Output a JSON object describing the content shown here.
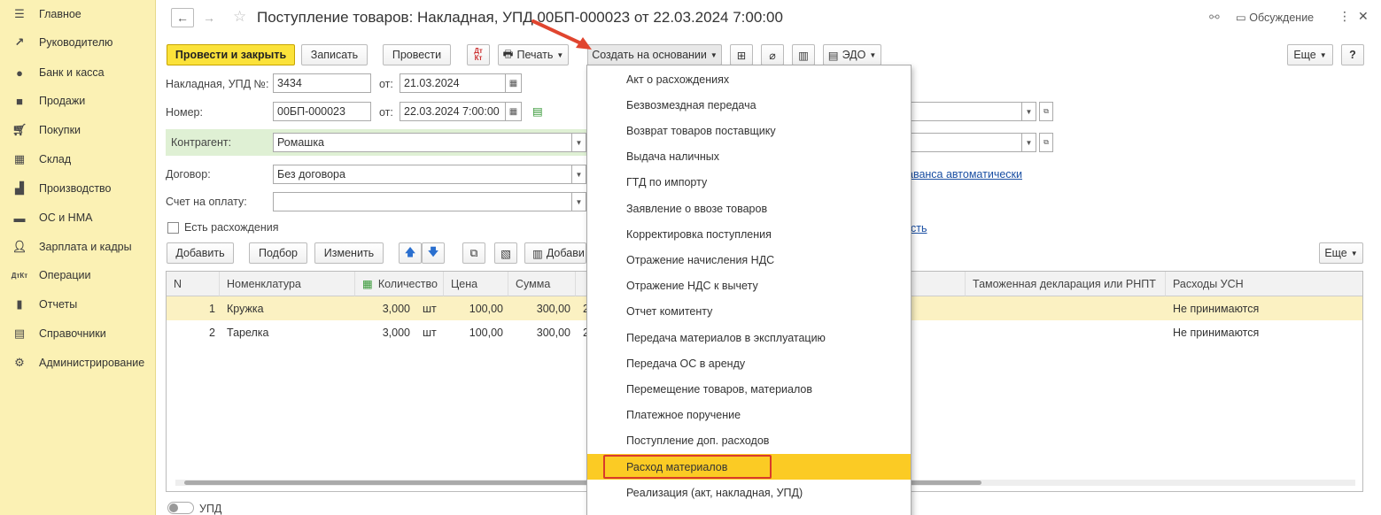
{
  "sidebar": {
    "items": [
      {
        "label": "Главное",
        "icon": "menu-icon"
      },
      {
        "label": "Руководителю",
        "icon": "trend-icon"
      },
      {
        "label": "Банк и касса",
        "icon": "coin-icon"
      },
      {
        "label": "Продажи",
        "icon": "bag-icon"
      },
      {
        "label": "Покупки",
        "icon": "cart-icon"
      },
      {
        "label": "Склад",
        "icon": "grid-icon"
      },
      {
        "label": "Производство",
        "icon": "factory-icon"
      },
      {
        "label": "ОС и НМА",
        "icon": "truck-icon"
      },
      {
        "label": "Зарплата и кадры",
        "icon": "person-icon"
      },
      {
        "label": "Операции",
        "icon": "dt-kt-icon"
      },
      {
        "label": "Отчеты",
        "icon": "bar-chart-icon"
      },
      {
        "label": "Справочники",
        "icon": "book-icon"
      },
      {
        "label": "Администрирование",
        "icon": "gear-icon"
      }
    ]
  },
  "header": {
    "title": "Поступление товаров: Накладная, УПД 00БП-000023 от 22.03.2024 7:00:00",
    "discussion": "Обсуждение"
  },
  "toolbar": {
    "post_close": "Провести и закрыть",
    "save": "Записать",
    "post": "Провести",
    "print": "Печать",
    "create_based": "Создать на основании",
    "edo": "ЭДО",
    "more": "Еще",
    "help": "?"
  },
  "form": {
    "invoice_label": "Накладная, УПД №:",
    "invoice_value": "3434",
    "from_label": "от:",
    "invoice_date": "21.03.2024",
    "number_label": "Номер:",
    "number_value": "00БП-000023",
    "number_date": "22.03.2024  7:00:00",
    "counterparty_label": "Контрагент:",
    "counterparty_value": "Ромашка",
    "contract_label": "Договор:",
    "contract_value": "Без договора",
    "payment_label": "Счет на оплату:",
    "payment_value": "",
    "discrepancy_label": "Есть расхождения",
    "advance_link": "аванса автоматически",
    "link_tail": "сть"
  },
  "table_toolbar": {
    "add": "Добавить",
    "pick": "Подбор",
    "change": "Изменить",
    "add2": "Добави",
    "more": "Еще"
  },
  "table": {
    "headers": {
      "n": "N",
      "item": "Номенклатура",
      "qty": "Количество",
      "price": "Цена",
      "sum": "Сумма",
      "customs": "Таможенная декларация или РНПТ",
      "usn": "Расходы УСН"
    },
    "rows": [
      {
        "n": "1",
        "item": "Кружка",
        "qty": "3,000",
        "unit": "шт",
        "price": "100,00",
        "sum": "300,00",
        "extra": "2",
        "usn": "Не принимаются"
      },
      {
        "n": "2",
        "item": "Тарелка",
        "qty": "3,000",
        "unit": "шт",
        "price": "100,00",
        "sum": "300,00",
        "extra": "2",
        "usn": "Не принимаются"
      }
    ]
  },
  "menu": {
    "items": [
      "Акт о расхождениях",
      "Безвозмездная передача",
      "Возврат товаров поставщику",
      "Выдача наличных",
      "ГТД по импорту",
      "Заявление о ввозе товаров",
      "Корректировка поступления",
      "Отражение начисления НДС",
      "Отражение НДС к вычету",
      "Отчет комитенту",
      "Передача материалов в эксплуатацию",
      "Передача ОС в аренду",
      "Перемещение товаров, материалов",
      "Платежное поручение",
      "Поступление доп. расходов",
      "Расход материалов",
      "Реализация (акт, накладная, УПД)"
    ],
    "highlighted_index": 15
  },
  "footer": {
    "upd_label": "УПД"
  },
  "colors": {
    "sidebar_bg": "#fbf1b4",
    "primary_button": "#fbe23a",
    "menu_highlight": "#fbcb24",
    "highlight_border": "#d93a2b",
    "selected_row": "#fbf1c2"
  }
}
